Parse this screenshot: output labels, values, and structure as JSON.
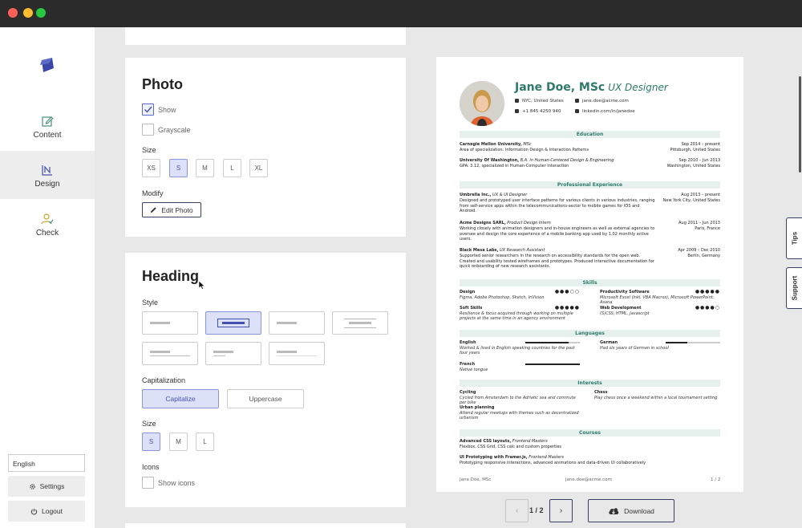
{
  "sidebar": {
    "items": [
      {
        "label": "Content"
      },
      {
        "label": "Design"
      },
      {
        "label": "Check"
      }
    ],
    "language": "English",
    "settings_label": "Settings",
    "logout_label": "Logout"
  },
  "photo": {
    "title": "Photo",
    "show_label": "Show",
    "show_checked": true,
    "grayscale_label": "Grayscale",
    "grayscale_checked": false,
    "size_label": "Size",
    "sizes": [
      "XS",
      "S",
      "M",
      "L",
      "XL"
    ],
    "selected_size": "S",
    "modify_label": "Modify",
    "edit_label": "Edit Photo"
  },
  "heading": {
    "title": "Heading",
    "style_label": "Style",
    "capitalization_label": "Capitalization",
    "capitalize_label": "Capitalize",
    "uppercase_label": "Uppercase",
    "selected_capitalization": "Capitalize",
    "size_label": "Size",
    "sizes": [
      "S",
      "M",
      "L"
    ],
    "selected_size": "S",
    "icons_label": "Icons",
    "show_icons_label": "Show icons",
    "show_icons_checked": false
  },
  "resume": {
    "name": "Jane Doe, MSc",
    "title": "UX Designer",
    "location": "NYC, United States",
    "email": "jane.doe@acme.com",
    "phone": "+1 845 4250 940",
    "linkedin": "linkedin.com/in/janedoe",
    "sections": {
      "education": "Education",
      "experience": "Professional Experience",
      "skills": "Skills",
      "languages": "Languages",
      "interests": "Interests",
      "courses": "Courses"
    },
    "education": [
      {
        "school": "Carnegie Mellon University,",
        "degree": "MSc",
        "detail": "Area of specialization: Information Design & Interaction Patterns",
        "date": "Sep 2014 – present",
        "place": "Pittsburgh, United States"
      },
      {
        "school": "University Of Washington,",
        "degree": "B.A. in Human-Centered Design & Engineering",
        "detail": "GPA: 3.12, specialized in Human-Computer Interaction",
        "date": "Sep 2010 – Jun 2013",
        "place": "Washington, United States"
      }
    ],
    "experience": [
      {
        "company": "Umbrella Inc.,",
        "role": "UX & UI Designer",
        "detail": "Designed and prototyped user interface patterns for various clients in various industries, ranging from self-service apps within the telecommunications-sector to mobile games for IOS and Android.",
        "date": "Aug 2013 – present",
        "place": "New York City, United States"
      },
      {
        "company": "Acme Designs SARL,",
        "role": "Product Design Intern",
        "detail": "Working closely with animation designers and in-house engineers as well as external agencies to oversee and design the core experience of a mobile banking app used by 1.02 monthly active users.",
        "date": "Aug 2011 – Jun 2013",
        "place": "Paris, France"
      },
      {
        "company": "Black Mesa Labs,",
        "role": "UX Research Assistant",
        "detail": "Supported senior researchers in the research on accessibility standards for the open web. Created and usability tested wireframes and prototypes. Produced interactive documentation for quick onboarding of new research assistants.",
        "date": "Apr 2009 – Dec 2010",
        "place": "Berlin, Germany"
      }
    ],
    "skills": [
      {
        "name": "Design",
        "detail": "Figma, Adobe Photoshop, Sketch, InVision",
        "level": "●●●○○"
      },
      {
        "name": "Productivity Software",
        "detail": "Microsoft Excel (inkl. VBA Macros), Microsoft PowerPoint, Asana",
        "level": "●●●●●"
      },
      {
        "name": "Soft Skills",
        "detail": "Resilience & focus acquired through working on multiple projects at the same time in an agency environment",
        "level": "●●●●●"
      },
      {
        "name": "Web Development",
        "detail": "(S)CSS, HTML, Javascript",
        "level": "●●●●○"
      }
    ],
    "languages": [
      {
        "name": "English",
        "detail": "Worked & lived in English speaking countries for the past four years",
        "level": 0.8
      },
      {
        "name": "German",
        "detail": "Had six years of German in school",
        "level": 0.4
      },
      {
        "name": "French",
        "detail": "Native tongue",
        "level": 1.0
      }
    ],
    "interests": [
      {
        "name": "Cycling",
        "detail": "Cycled from Amsterdam to the Adriatic sea and commute per bike"
      },
      {
        "name": "Chess",
        "detail": "Play chess once a weekend within a local tournament setting"
      },
      {
        "name": "Urban planning",
        "detail": "Attend regular meetups with themes such as decentralized urbanism"
      }
    ],
    "courses": [
      {
        "name": "Advanced CSS layouts,",
        "org": "Frontend Masters",
        "detail": "Flexbox, CSS Grid, CSS calc and custom properties"
      },
      {
        "name": "UI Prototyping with Framer.js,",
        "org": "Frontend Masters",
        "detail": "Prototyping responsive interactions, advanced animations and data-driven UI collaboratively"
      }
    ],
    "footer_name": "Jane Doe, MSc",
    "footer_email": "jane.doe@acme.com",
    "footer_page": "1 / 2"
  },
  "pager": {
    "prev": "‹",
    "label": "1 / 2",
    "next": "›",
    "download_label": "Download"
  },
  "tabs": {
    "tips": "Tips",
    "support": "Support"
  },
  "colors": {
    "accent": "#5b6ac7",
    "resume_accent": "#2d7a6a"
  }
}
